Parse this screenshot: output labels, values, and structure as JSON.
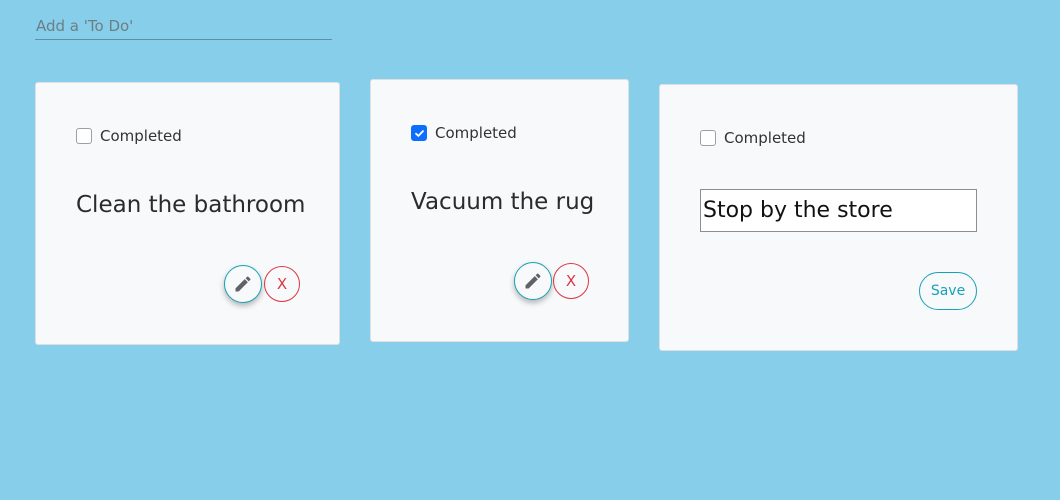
{
  "add_todo": {
    "placeholder": "Add a 'To Do'",
    "value": ""
  },
  "todos": [
    {
      "completed": false,
      "completed_label": "Completed",
      "text": "Clean the bathroom",
      "delete_label": "X",
      "edit_icon": "pencil-icon"
    },
    {
      "completed": true,
      "completed_label": "Completed",
      "text": "Vacuum the rug",
      "delete_label": "X",
      "edit_icon": "pencil-icon"
    },
    {
      "completed": false,
      "completed_label": "Completed",
      "editing": true,
      "input_value": "Stop by the store",
      "save_label": "Save"
    }
  ],
  "colors": {
    "background": "#87ceeb",
    "card": "#f8f9fa",
    "edit_accent": "#17a2b8",
    "delete_accent": "#dc3545",
    "checked": "#0d6efd"
  }
}
